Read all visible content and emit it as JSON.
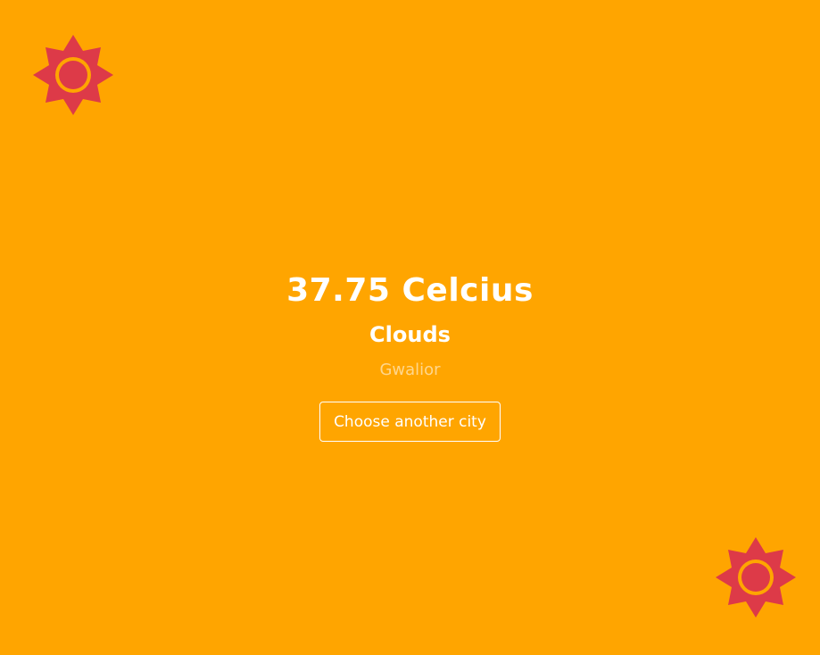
{
  "icons": {
    "top_left": "sun-icon",
    "bottom_right": "sun-icon"
  },
  "colors": {
    "background": "#FFA500",
    "sun": "#DD3A48",
    "sun_ring": "#FFA500",
    "text": "#FFFFFF"
  },
  "weather": {
    "temperature": "37.75 Celcius",
    "condition": "Clouds",
    "city": "Gwalior"
  },
  "actions": {
    "choose_city_label": "Choose another city"
  }
}
